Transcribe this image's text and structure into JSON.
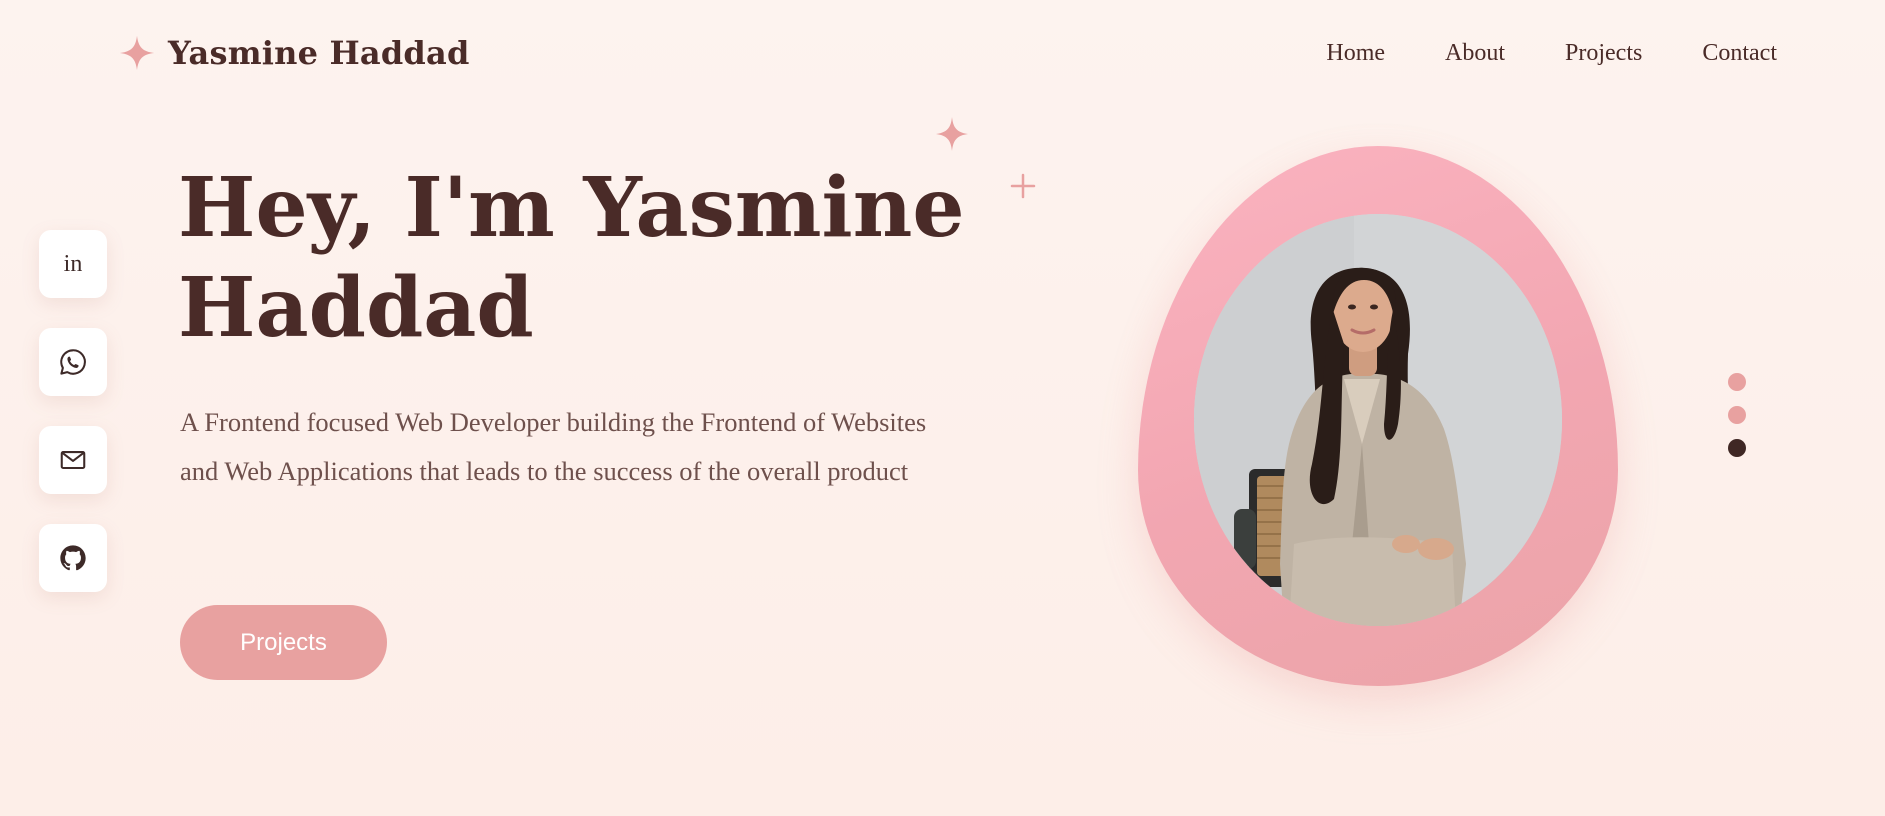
{
  "brand": {
    "name": "Yasmine Haddad",
    "icon": "sparkle-icon",
    "accent_color": "#e8a1a0"
  },
  "nav": {
    "items": [
      {
        "label": "Home"
      },
      {
        "label": "About"
      },
      {
        "label": "Projects"
      },
      {
        "label": "Contact"
      }
    ]
  },
  "social": {
    "items": [
      {
        "name": "linkedin",
        "icon": "linkedin-icon",
        "glyph": "in"
      },
      {
        "name": "whatsapp",
        "icon": "whatsapp-icon"
      },
      {
        "name": "email",
        "icon": "mail-icon"
      },
      {
        "name": "github",
        "icon": "github-icon"
      }
    ]
  },
  "hero": {
    "headline_line1": "Hey, I'm Yasmine",
    "headline_line2": "Haddad",
    "description": "A Frontend focused Web Developer building the Frontend of Websites and Web Applications that leads to the success of the overall product",
    "cta_label": "Projects"
  },
  "carousel": {
    "dot_count": 3,
    "active_index": 2,
    "dot_color": "#e8a1a0",
    "active_color": "#3f2724"
  },
  "colors": {
    "background": "#fdf1ec",
    "text_dark": "#4a2b28",
    "text_muted": "#6e504c",
    "blob_pink": "#f6aab6"
  }
}
